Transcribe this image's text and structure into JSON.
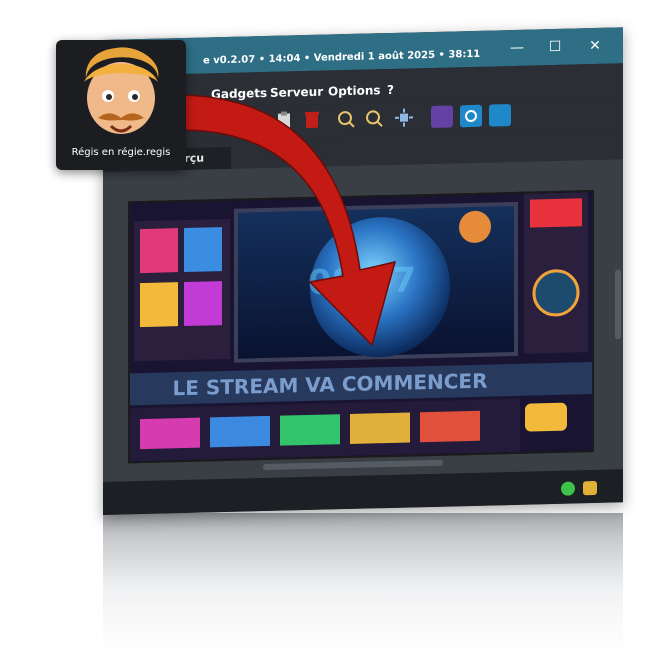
{
  "window": {
    "title": "e v0.2.07 • 14:04 • Vendredi 1 août 2025 • 38:11",
    "controls": {
      "minimize": "—",
      "maximize": "☐",
      "close": "✕"
    }
  },
  "menu": {
    "items": [
      {
        "label": "Gadgets"
      },
      {
        "label": "Serveur"
      },
      {
        "label": "Options"
      },
      {
        "label": "?"
      }
    ]
  },
  "tabs": {
    "active": "perçu"
  },
  "preview": {
    "clock": "08:47",
    "banner": "LE STREAM VA COMMENCER"
  },
  "tooltip": {
    "label": "Régis en régie.regis"
  },
  "colors": {
    "titlebar": "#2f6f86",
    "arrow": "#c41a14"
  }
}
